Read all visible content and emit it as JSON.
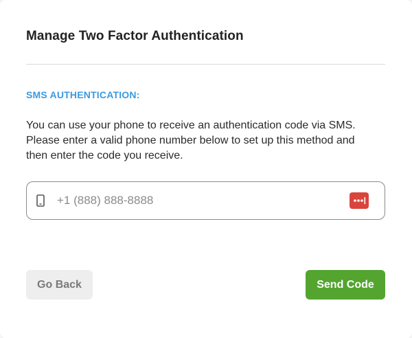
{
  "dialog": {
    "title": "Manage Two Factor Authentication",
    "section_label": "SMS AUTHENTICATION:",
    "description_lines": [
      "You can use your phone to receive an authentication code via SMS.",
      "Please enter a valid phone number below to set up this method and",
      "then enter the code you receive."
    ]
  },
  "phone_field": {
    "placeholder": "+1 (888) 888-8888",
    "value": "",
    "leading_icon": "mobile-phone-icon",
    "trailing_icon": "password-manager-icon"
  },
  "buttons": {
    "back_label": "Go Back",
    "send_label": "Send Code"
  },
  "colors": {
    "accent_blue": "#3a9ae0",
    "primary_green": "#53a530",
    "password_manager_red": "#d9453c"
  }
}
